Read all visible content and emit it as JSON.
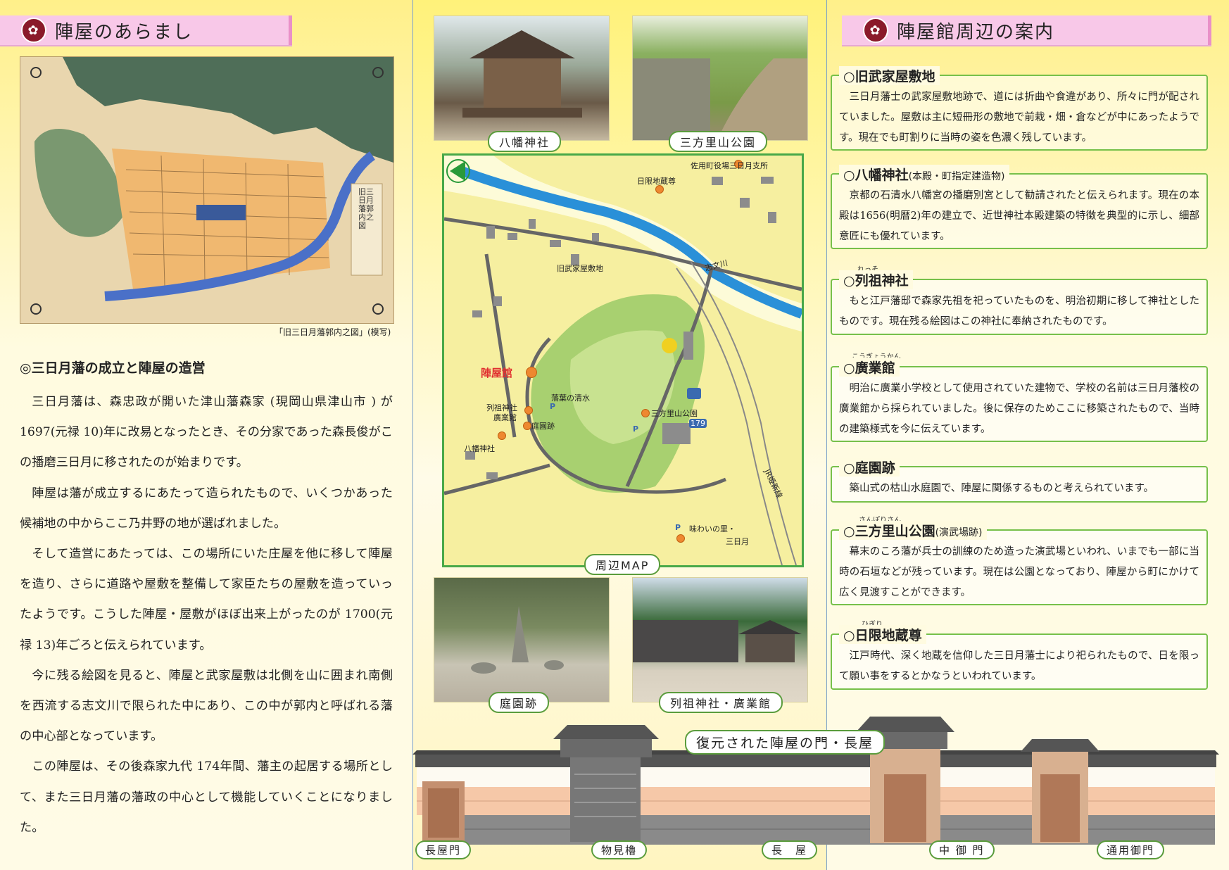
{
  "left": {
    "heading": "陣屋のあらまし",
    "map_caption": "「旧三日月藩郭内之図」(模写)",
    "map_inner_text": "旧三日月藩郭内之図",
    "subtitle": "◎三日月藩の成立と陣屋の造営",
    "paragraphs": [
      "三日月藩は、森忠政が開いた津山藩森家 (現岡山県津山市 ) が 1697(元禄 10)年に改易となったとき、その分家であった森長俊がこの播磨三日月に移されたのが始まりです。",
      "陣屋は藩が成立するにあたって造られたもので、いくつかあった候補地の中からここ乃井野の地が選ばれました。",
      "そして造営にあたっては、この場所にいた庄屋を他に移して陣屋を造り、さらに道路や屋敷を整備して家臣たちの屋敷を造っていったようです。こうした陣屋・屋敷がほぼ出来上がったのが 1700(元禄 13)年ごろと伝えられています。",
      "今に残る絵図を見ると、陣屋と武家屋敷は北側を山に囲まれ南側を西流する志文川で限られた中にあり、この中が郭内と呼ばれる藩の中心部となっています。",
      "この陣屋は、その後森家九代 174年間、藩主の起居する場所として、また三日月藩の藩政の中心として機能していくことになりました。"
    ]
  },
  "middle": {
    "photo_labels": [
      "八幡神社",
      "三方里山公園",
      "庭園跡",
      "列祖神社・廣業館"
    ],
    "map_title": "周辺MAP",
    "map_labels": {
      "office": "佐用町役場三日月支所",
      "jizo": "日限地蔵尊",
      "river": "志文川",
      "samurai": "旧武家屋敷地",
      "jinya": "陣屋館",
      "ochiba": "落葉の清水",
      "resso": "列祖神社",
      "kogyo": "廣業館",
      "teien": "庭園跡",
      "hachiman": "八幡神社",
      "park": "三方里山公園",
      "route": "179",
      "p": "P",
      "ajiwai1": "味わいの里・",
      "ajiwai2": "三日月",
      "rail": "JR姫新線"
    },
    "gate_title": "復元された陣屋の門・長屋",
    "gate_labels": [
      "長屋門",
      "物見櫓",
      "長　屋",
      "中 御 門",
      "通用御門"
    ]
  },
  "right": {
    "heading": "陣屋館周辺の案内",
    "items": [
      {
        "ruby": "",
        "title": "○旧武家屋敷地",
        "note": "",
        "text": "三日月藩士の武家屋敷地跡で、道には折曲や食違があり、所々に門が配されていました。屋敷は主に短冊形の敷地で前栽・畑・倉などが中にあったようです。現在でも町割りに当時の姿を色濃く残しています。"
      },
      {
        "ruby": "",
        "title": "○八幡神社",
        "note": "(本殿・町指定建造物)",
        "text": "京都の石清水八幡宮の播磨別宮として勧請されたと伝えられます。現在の本殿は1656(明暦2)年の建立で、近世神社本殿建築の特徴を典型的に示し、細部意匠にも優れています。"
      },
      {
        "ruby": "れっそ",
        "title": "○列祖神社",
        "note": "",
        "text": "もと江戸藩邸で森家先祖を祀っていたものを、明治初期に移して神社としたものです。現在残る絵図はこの神社に奉納されたものです。"
      },
      {
        "ruby": "こうぎょうかん",
        "title": "○廣業館",
        "note": "",
        "text": "明治に廣業小学校として使用されていた建物で、学校の名前は三日月藩校の廣業館から採られていました。後に保存のためここに移築されたもので、当時の建築様式を今に伝えています。"
      },
      {
        "ruby": "",
        "title": "○庭園跡",
        "note": "",
        "text": "築山式の枯山水庭園で、陣屋に関係するものと考えられています。"
      },
      {
        "ruby": "さんぽりさん",
        "title": "○三方里山公園",
        "note": "(演武場跡)",
        "text": "幕末のころ藩が兵士の訓練のため造った演武場といわれ、いまでも一部に当時の石垣などが残っています。現在は公園となっており、陣屋から町にかけて広く見渡すことができます。"
      },
      {
        "ruby": "ひぎり",
        "title": "○日限地蔵尊",
        "note": "",
        "text": "江戸時代、深く地蔵を信仰した三日月藩士により祀られたもので、日を限って願い事をするとかなうといわれています。"
      }
    ]
  }
}
